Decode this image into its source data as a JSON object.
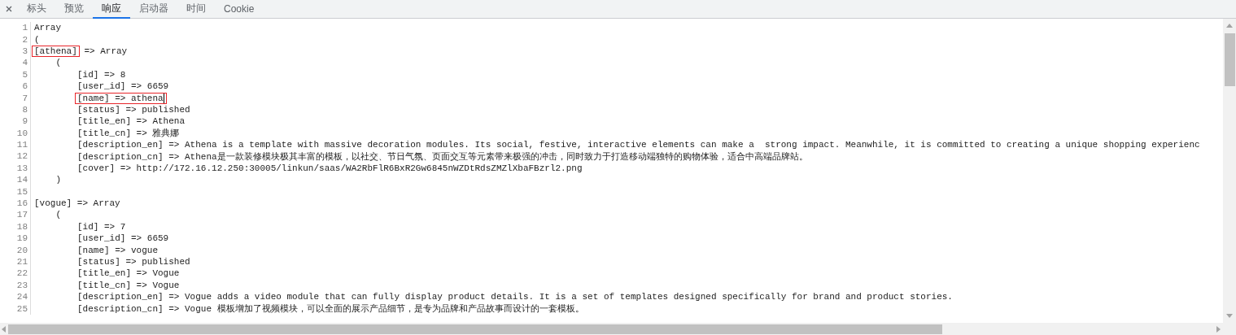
{
  "tabs": [
    {
      "label": "标头",
      "selected": false
    },
    {
      "label": "预览",
      "selected": false
    },
    {
      "label": "响应",
      "selected": true
    },
    {
      "label": "启动器",
      "selected": false
    },
    {
      "label": "时间",
      "selected": false
    },
    {
      "label": "Cookie",
      "selected": false
    }
  ],
  "code": [
    {
      "n": "1",
      "text": "Array"
    },
    {
      "n": "2",
      "text": "("
    },
    {
      "n": "3",
      "marked": "[athena]",
      "text": "=> Array",
      "children": [
        {
          "n": "4",
          "text": "(",
          "children": [
            {
              "n": "5",
              "text": "[id] => 8"
            },
            {
              "n": "6",
              "text": "[user_id] => 6659"
            },
            {
              "n": "7",
              "marked": "[name] => athena",
              "cursor": true
            },
            {
              "n": "8",
              "text": "[status] => published"
            },
            {
              "n": "9",
              "text": "[title_en] => Athena"
            },
            {
              "n": "10",
              "text": "[title_cn] => 雅典娜"
            },
            {
              "n": "11",
              "text": "[description_en] => Athena is a template with massive decoration modules. Its social, festive, interactive elements can make a  strong impact. Meanwhile, it is committed to creating a unique shopping experienc"
            },
            {
              "n": "12",
              "text": "[description_cn] => Athena是一款装修模块极其丰富的模板，以社交、节日气氛、页面交互等元素带来极强的冲击，同时致力于打造移动端独特的购物体验，适合中高端品牌站。"
            },
            {
              "n": "13",
              "text": "[cover] => http://172.16.12.250:30005/linkun/saas/WA2RbFlR6BxR2Gw6845nWZDtRdsZMZlXbaFBzrl2.png"
            }
          ]
        },
        {
          "n": "14",
          "text": ")"
        }
      ]
    },
    {
      "n": "15"
    },
    {
      "n": "16",
      "text": "[vogue] => Array",
      "children": [
        {
          "n": "17",
          "text": "(",
          "children": [
            {
              "n": "18",
              "text": "[id] => 7"
            },
            {
              "n": "19",
              "text": "[user_id] => 6659"
            },
            {
              "n": "20",
              "text": "[name] => vogue"
            },
            {
              "n": "21",
              "text": "[status] => published"
            },
            {
              "n": "22",
              "text": "[title_en] => Vogue"
            },
            {
              "n": "23",
              "text": "[title_cn] => Vogue"
            },
            {
              "n": "24",
              "text": "[description_en] => Vogue adds a video module that can fully display product details. It is a set of templates designed specifically for brand and product stories."
            },
            {
              "n": "25",
              "text": "[description_cn] => Vogue 模板增加了视频模块，可以全面的展示产品细节，是专为品牌和产品故事而设计的一套模板。"
            }
          ]
        }
      ]
    }
  ]
}
